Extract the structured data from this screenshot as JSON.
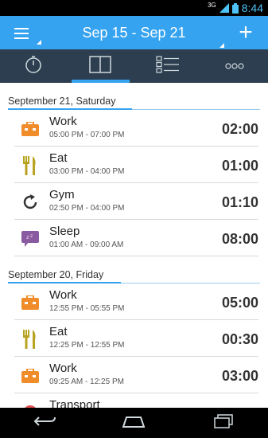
{
  "status_bar": {
    "network": "3G",
    "time": "8:44"
  },
  "app_bar": {
    "date_range": "Sep 15 - Sep 21",
    "add_label": "+"
  },
  "tabs": [
    {
      "icon": "stopwatch-icon",
      "active": false
    },
    {
      "icon": "book-icon",
      "active": true
    },
    {
      "icon": "list-icon",
      "active": false
    },
    {
      "icon": "more-icon",
      "active": false
    }
  ],
  "sections": [
    {
      "date": "September 21, Saturday",
      "entries": [
        {
          "name": "Work",
          "time": "05:00 PM - 07:00 PM",
          "duration": "02:00",
          "icon": "briefcase-icon"
        },
        {
          "name": "Eat",
          "time": "03:00 PM - 04:00 PM",
          "duration": "01:00",
          "icon": "fork-knife-icon"
        },
        {
          "name": "Gym",
          "time": "02:50 PM - 04:00 PM",
          "duration": "01:10",
          "icon": "refresh-icon"
        },
        {
          "name": "Sleep",
          "time": "01:00 AM - 09:00 AM",
          "duration": "08:00",
          "icon": "sleep-bubble-icon"
        }
      ]
    },
    {
      "date": "September 20, Friday",
      "entries": [
        {
          "name": "Work",
          "time": "12:55 PM - 05:55 PM",
          "duration": "05:00",
          "icon": "briefcase-icon"
        },
        {
          "name": "Eat",
          "time": "12:25 PM - 12:55 PM",
          "duration": "00:30",
          "icon": "fork-knife-icon"
        },
        {
          "name": "Work",
          "time": "09:25 AM - 12:25 PM",
          "duration": "03:00",
          "icon": "briefcase-icon"
        },
        {
          "name": "Transport",
          "time": "",
          "duration": "",
          "icon": "transport-icon"
        }
      ]
    }
  ],
  "colors": {
    "accent": "#35a3f0",
    "tab_bar": "#2c3e4f",
    "briefcase": "#f08c2a",
    "fork": "#b8a321",
    "sleep": "#8a5aa0"
  }
}
